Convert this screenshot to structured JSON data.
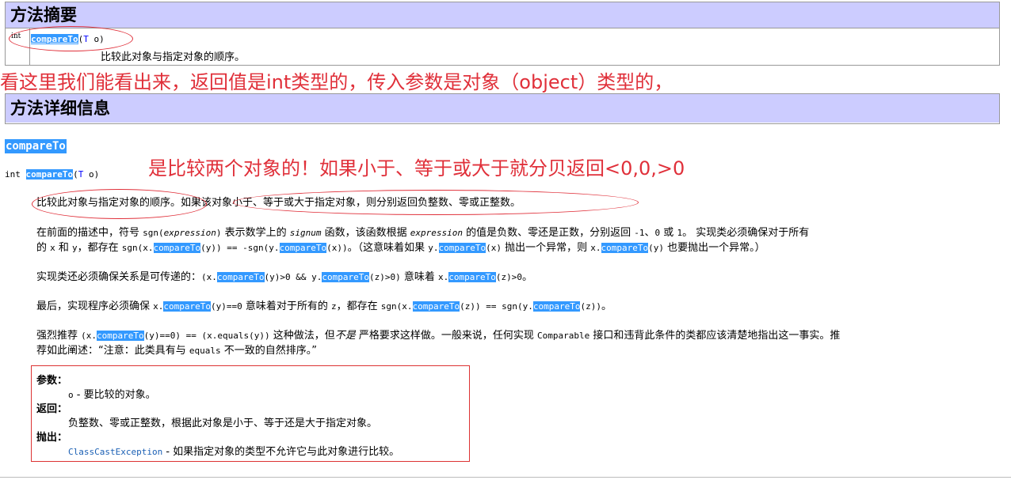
{
  "summary": {
    "title": "方法摘要",
    "return_type": "int",
    "method_name": "compareTo",
    "param_type": "T",
    "param_name": "o",
    "description": "比较此对象与指定对象的顺序。"
  },
  "annotation1": "看这里我们能看出来，返回值是int类型的，传入参数是对象（object）类型的，",
  "detail": {
    "title": "方法详细信息",
    "method_name": "compareTo",
    "sig_return": "int",
    "sig_name": "compareTo",
    "sig_param_type": "T",
    "sig_param_name": "o"
  },
  "annotation2": "是比较两个对象的！如果小于、等于或大于就分贝返回<0,0,>0",
  "paragraphs": {
    "p1": "比较此对象与指定对象的顺序。如果该对象小于、等于或大于指定对象，则分别返回负整数、零或正整数。",
    "p2a": "在前面的描述中，符号 ",
    "p2b": "sgn(",
    "p2c": "expression",
    "p2d": ")",
    "p2e": " 表示数学上的 ",
    "p2f": "signum",
    "p2g": " 函数，该函数根据 ",
    "p2h": "expression",
    "p2i": " 的值是负数、零还是正数，分别返回 ",
    "p2j": "-1",
    "p2k": "、",
    "p2l": "0",
    "p2m": " 或 ",
    "p2n": "1",
    "p2o": "。 实现类必须确保对于所有",
    "p2p": "的 ",
    "p2q": "x",
    "p2r": " 和 ",
    "p2s": "y",
    "p2t": "，都存在 ",
    "p2u": "sgn(x.",
    "p2v": "compareTo",
    "p2w": "(y)) == -sgn(y.",
    "p2x": "compareTo",
    "p2y": "(x))",
    "p2z": "。（这意味着如果 ",
    "p2aa": "y.",
    "p2ab": "compareTo",
    "p2ac": "(x)",
    "p2ad": " 抛出一个异常，则 ",
    "p2ae": "x.",
    "p2af": "compareTo",
    "p2ag": "(y)",
    "p2ah": " 也要抛出一个异常。）",
    "p3a": "实现类还必须确保关系是可传递的：",
    "p3b": "(x.",
    "p3c": "compareTo",
    "p3d": "(y)>0 && y.",
    "p3e": "compareTo",
    "p3f": "(z)>0)",
    "p3g": " 意味着 ",
    "p3h": "x.",
    "p3i": "compareTo",
    "p3j": "(z)>0",
    "p3k": "。",
    "p4a": "最后，实现程序必须确保 ",
    "p4b": "x.",
    "p4c": "compareTo",
    "p4d": "(y)==0",
    "p4e": " 意味着对于所有的 ",
    "p4f": "z",
    "p4g": "，都存在 ",
    "p4h": "sgn(x.",
    "p4i": "compareTo",
    "p4j": "(z)) == sgn(y.",
    "p4k": "compareTo",
    "p4l": "(z))",
    "p4m": "。",
    "p5a": "强烈推荐 ",
    "p5b": "(x.",
    "p5c": "compareTo",
    "p5d": "(y)==0) == (x.equals(y))",
    "p5e": " 这种做法，但",
    "p5f": "不是",
    "p5g": " 严格要求这样做。一般来说，任何实现 ",
    "p5h": "Comparable",
    "p5i": " 接口和违背此条件的类都应该清楚地指出这一事实。推",
    "p5j": "荐如此阐述：“注意：此类具有与 ",
    "p5k": "equals",
    "p5l": " 不一致的自然排序。”"
  },
  "params": {
    "params_label": "参数：",
    "param_name": "o",
    "param_desc": " - 要比较的对象。",
    "returns_label": "返回：",
    "returns_desc": "负整数、零或正整数，根据此对象是小于、等于还是大于指定对象。",
    "throws_label": "抛出：",
    "exception": "ClassCastException",
    "throws_desc": " - 如果指定对象的类型不允许它与此对象进行比较。"
  },
  "colors": {
    "header_bg": "#ccccff",
    "highlight": "#3399ff",
    "annotation": "#e0303a",
    "link": "#0000ff"
  }
}
